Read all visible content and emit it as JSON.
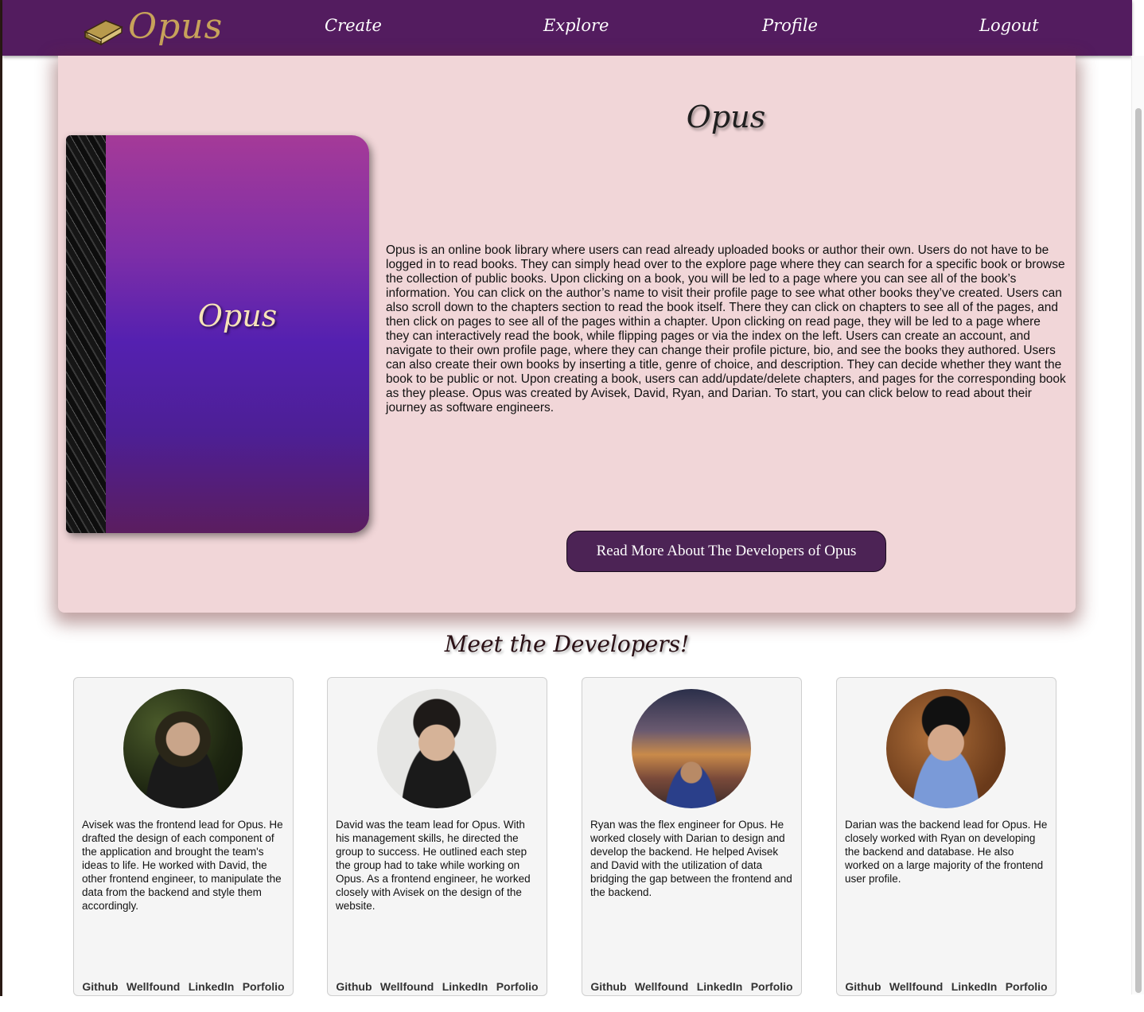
{
  "nav": {
    "logo_text": "Opus",
    "links": [
      "Create",
      "Explore",
      "Profile",
      "Logout"
    ]
  },
  "hero": {
    "book_title": "Opus",
    "title": "Opus",
    "description": "Opus is an online book library where users can read already uploaded books or author their own. Users do not have to be logged in to read books. They can simply head over to the explore page where they can search for a specific book or browse the collection of public books. Upon clicking on a book, you will be led to a page where you can see all of the book’s information. You can click on the author’s name to visit their profile page to see what other books they’ve created. Users can also scroll down to the chapters section to read the book itself. There they can click on chapters to see all of the pages, and then click on pages to see all of the pages within a chapter. Upon clicking on read page, they will be led to a page where they can interactively read the book, while flipping pages or via the index on the left. Users can create an account, and navigate to their own profile page, where they can change their profile picture, bio, and see the books they authored. Users can also create their own books by inserting a title, genre of choice, and description. They can decide whether they want the book to be public or not. Upon creating a book, users can add/update/delete chapters, and pages for the corresponding book as they please. Opus was created by Avisek, David, Ryan, and Darian. To start, you can click below to read about their journey as software engineers.",
    "button_label": "Read More About The Developers of Opus"
  },
  "developers_section": {
    "title": "Meet the Developers!",
    "link_labels": [
      "Github",
      "Wellfound",
      "LinkedIn",
      "Porfolio"
    ],
    "developers": [
      {
        "bio": "Avisek was the frontend lead for Opus. He drafted the design of each component of the application and brought the team's ideas to life. He worked with David, the other frontend engineer, to manipulate the data from the backend and style them accordingly."
      },
      {
        "bio": "David was the team lead for Opus. With his management skills, he directed the group to success. He outlined each step the group had to take while working on Opus. As a frontend engineer, he worked closely with Avisek on the design of the website."
      },
      {
        "bio": "Ryan was the flex engineer for Opus. He worked closely with Darian to design and develop the backend. He helped Avisek and David with the utilization of data bridging the gap between the frontend and the backend."
      },
      {
        "bio": "Darian was the backend lead for Opus. He closely worked with Ryan on developing the backend and database. He also worked on a large majority of the frontend user profile."
      }
    ]
  },
  "colors": {
    "nav_bg": "#531c5f",
    "hero_bg": "#f1d6d8",
    "button_bg": "#4c2355",
    "logo_gold": "#c7a25a"
  }
}
